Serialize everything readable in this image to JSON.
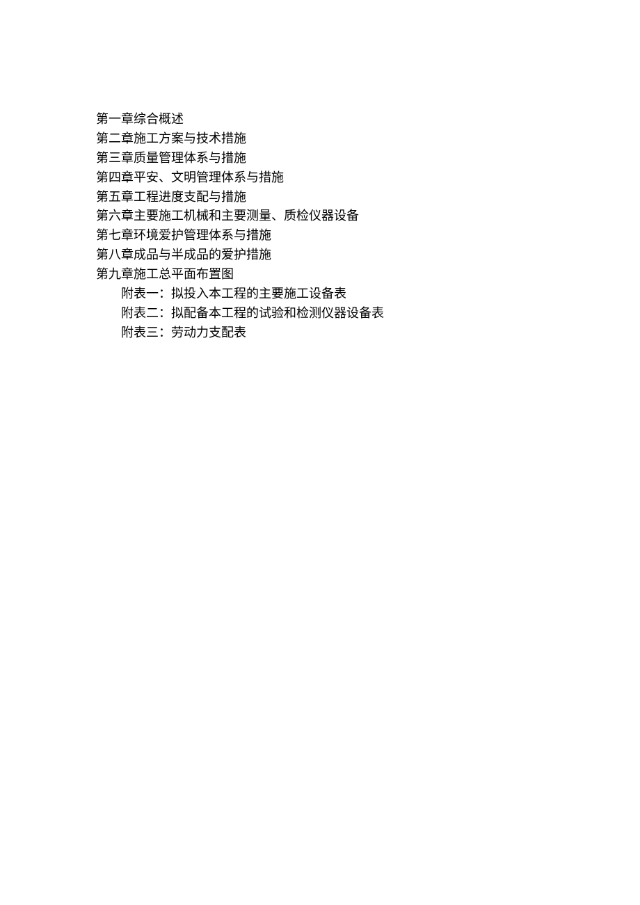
{
  "toc": {
    "chapters": [
      "第一章综合概述",
      "第二章施工方案与技术措施",
      "第三章质量管理体系与措施",
      "第四章平安、文明管理体系与措施",
      "第五章工程进度支配与措施",
      "第六章主要施工机械和主要测量、质检仪器设备",
      "第七章环境爱护管理体系与措施",
      "第八章成品与半成品的爱护措施",
      "第九章施工总平面布置图"
    ],
    "appendices": [
      "附表一：拟投入本工程的主要施工设备表",
      "附表二：拟配备本工程的试验和检测仪器设备表",
      "附表三：劳动力支配表"
    ]
  }
}
